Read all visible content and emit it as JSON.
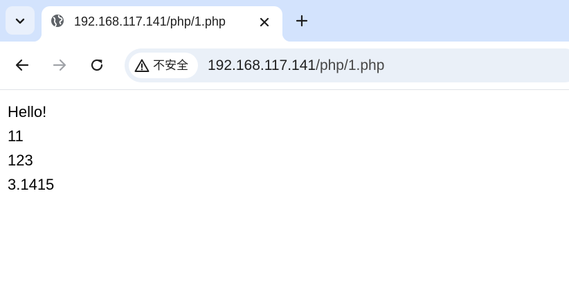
{
  "browser": {
    "tab": {
      "title": "192.168.117.141/php/1.php",
      "favicon": "globe-icon",
      "close_icon": "close-icon"
    },
    "tab_search_icon": "chevron-down-icon",
    "new_tab_icon": "plus-icon",
    "nav": {
      "back_icon": "arrow-left-icon",
      "forward_icon": "arrow-right-icon",
      "reload_icon": "reload-icon"
    },
    "address_bar": {
      "security_icon": "warning-icon",
      "security_label": "不安全",
      "url_host": "192.168.117.141",
      "url_path": "/php/1.php"
    },
    "colors": {
      "tabbar": "#d3e3fd",
      "omnibox": "#eaf0f8",
      "text": "#1f1f1f"
    }
  },
  "page": {
    "lines": [
      "Hello!",
      "11",
      "123",
      "3.1415"
    ]
  }
}
